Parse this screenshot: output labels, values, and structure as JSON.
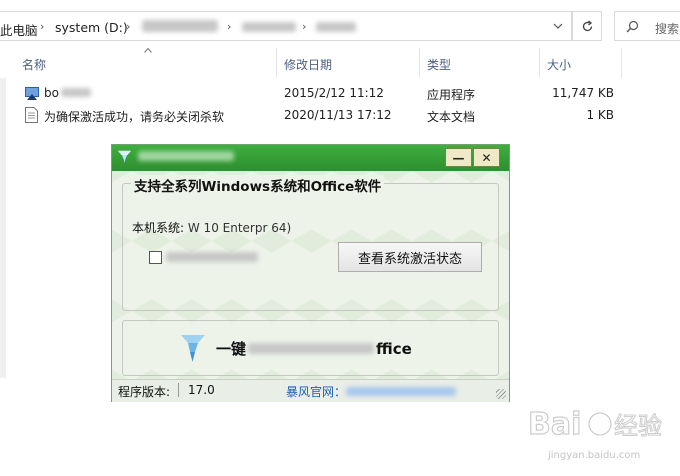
{
  "address_bar": {
    "crumbs": [
      "此电脑",
      "system (D:)",
      "",
      "",
      ""
    ],
    "refresh_icon": "refresh-icon",
    "dropdown_icon": "chevron-down-icon",
    "search_placeholder": "搜索"
  },
  "columns": {
    "name": "名称",
    "modified": "修改日期",
    "type": "类型",
    "size": "大小"
  },
  "files": [
    {
      "name": "bo",
      "date": "2015/2/12 11:12",
      "type": "应用程序",
      "size": "11,747 KB",
      "icon": "app-icon"
    },
    {
      "name": "为确保激活成功，请务必关闭杀软",
      "date": "2020/11/13 17:12",
      "type": "文本文档",
      "size": "1 KB",
      "icon": "text-file-icon"
    }
  ],
  "dialog": {
    "title": "",
    "minimize": "—",
    "close": "✕",
    "group_title": "支持全系列Windows系统和Office软件",
    "system_label": "本机系统:",
    "system_value": "W     10 Enterpr    64)",
    "check_status_button": "查看系统激活状态",
    "one_click_label": "一键",
    "one_click_suffix": "ffice",
    "version_label": "程序版本:",
    "version": "17.0",
    "site_label": "暴风官网：",
    "accent": "#2e9a2e"
  },
  "watermark": {
    "brand": "Baidu经验",
    "url": "jingyan.baidu.com"
  }
}
